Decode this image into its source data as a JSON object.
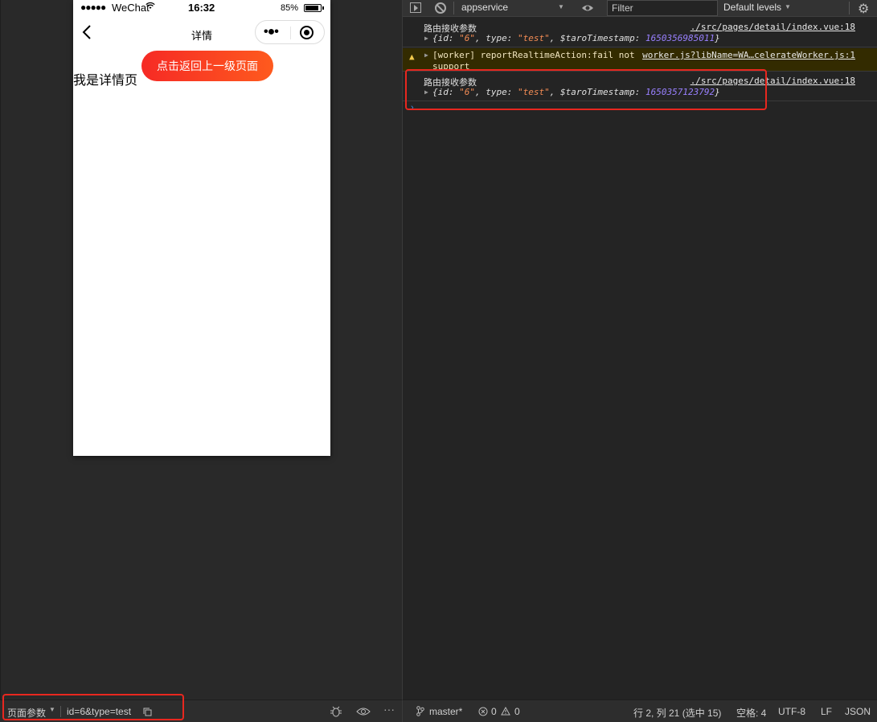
{
  "phone": {
    "status": {
      "dots": "●●●●●",
      "carrier": "WeChat",
      "wifi_icon": "wifi-icon",
      "time": "16:32",
      "battery_pct": "85%"
    },
    "nav": {
      "title": "详情",
      "back_icon": "chevron-left-icon",
      "more_icon": "more-dots-icon",
      "close_icon": "target-close-icon"
    },
    "page_text": "我是详情页",
    "back_button_label": "点击返回上一级页面"
  },
  "sim_bottom": {
    "label": "页面参数",
    "value": "id=6&type=test"
  },
  "console": {
    "toolbar": {
      "context": "appservice",
      "filter_placeholder": "Filter",
      "levels": "Default levels"
    },
    "logs": [
      {
        "message": "路由接收参数",
        "source": "./src/pages/detail/index.vue:18",
        "object": {
          "id": "6",
          "type": "test",
          "timestamp": "1650356985011"
        }
      },
      {
        "level": "warning",
        "message": "[worker] reportRealtimeAction:fail not support",
        "source": "worker.js?libName=WA…celerateWorker.js:1"
      },
      {
        "message": "路由接收参数",
        "source": "./src/pages/detail/index.vue:18",
        "object": {
          "id": "6",
          "type": "test",
          "timestamp": "1650357123792"
        }
      }
    ],
    "prompt": "›"
  },
  "status_bar": {
    "branch": "master*",
    "errors": "0",
    "warnings": "0",
    "cursor": "行 2, 列 21 (选中 15)",
    "indent": "空格: 4",
    "encoding": "UTF-8",
    "eol": "LF",
    "language": "JSON"
  },
  "colors": {
    "accent_red": "#e8271f",
    "button_start": "#f62a25",
    "button_end": "#fe5a1e",
    "string": "#f28b54",
    "number": "#9980ff"
  }
}
